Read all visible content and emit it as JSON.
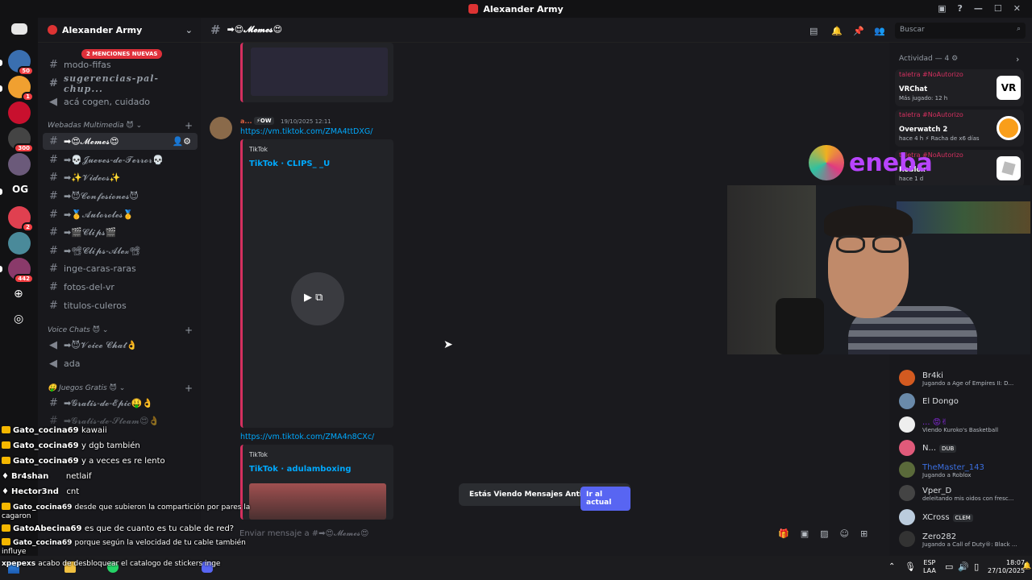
{
  "window": {
    "title": "Alexander Army"
  },
  "servers": {
    "badges": [
      "50",
      "1",
      "300",
      "2",
      "442"
    ],
    "og_label": "OG"
  },
  "server": {
    "name": "Alexander Army",
    "mention_banner": "2 MENCIONES NUEVAS"
  },
  "channels": {
    "top": [
      {
        "label": "modo-fifas"
      },
      {
        "label": "sugerencias-pal-chup..."
      },
      {
        "label": "acá cogen, cuidado"
      }
    ],
    "cat_media": "Webadas Multimedia",
    "media": [
      {
        "label": "➡😍𝓜𝓮𝓶𝓮𝓼😍"
      },
      {
        "label": "➡💀𝓙𝓾𝓮𝓿𝓮𝓼-𝓭𝓮-𝓣𝓮𝓻𝓻𝓸𝓻💀"
      },
      {
        "label": "➡✨𝓥𝓲𝓭𝓮𝓸𝓼✨"
      },
      {
        "label": "➡😈𝓒𝓸𝓷𝓯𝓮𝓼𝓲𝓸𝓷𝓮𝓼😈"
      },
      {
        "label": "➡🥇𝓐𝓾𝓽𝓸𝓻𝓸𝓵𝓮𝓼🥇"
      },
      {
        "label": "➡🎬𝓒𝓵𝓲𝓹𝓼🎬"
      },
      {
        "label": "➡📽𝓒𝓵𝓲𝓹𝓼-𝓐𝓵𝓮𝔁📽"
      },
      {
        "label": "inge-caras-raras"
      },
      {
        "label": "fotos-del-vr"
      },
      {
        "label": "titulos-culeros"
      }
    ],
    "cat_voice": "Voice Chats",
    "voice": [
      {
        "label": "➡😈𝓥𝓸𝓲𝓬𝓮 𝓒𝓱𝓪𝓽👌"
      },
      {
        "label": "ada"
      }
    ],
    "cat_games": "Juegos Gratis",
    "games": [
      {
        "label": "➡𝓖𝓻𝓪𝓽𝓲𝓼-𝓭𝓮-𝓔𝓹𝓲𝓬🤑👌"
      },
      {
        "label": "➡𝓖𝓻𝓪𝓽𝓲𝓼-𝓭𝓮-𝓢𝓽𝓮𝓪𝓶😍👌"
      }
    ]
  },
  "header": {
    "channel": "➡😍𝓜𝓮𝓶𝓮𝓼😍",
    "search_placeholder": "Buscar"
  },
  "messages": [
    {
      "author": "a...",
      "badge": "⚡OW",
      "time": "19/10/2025 12:11",
      "link": "https://vm.tiktok.com/ZMA4ttDXG/",
      "provider": "TikTok",
      "embed_title": "TikTok · CLIPS_ _U"
    },
    {
      "link": "https://vm.tiktok.com/ZMA4n8CXc/",
      "provider": "TikTok",
      "embed_title": "TikTok · adulamboxing"
    }
  ],
  "old_messages": {
    "text": "Estás Viendo Mensajes Antiguos",
    "button": "Ir al actual"
  },
  "composer": {
    "placeholder": "Enviar mensaje a #➡😍𝓜𝓮𝓶𝓮𝓼😍"
  },
  "activity": {
    "header": "Actividad — 4",
    "cards": [
      {
        "user": "taletra #NoAutorizo",
        "game": "VRChat",
        "sub": "Más jugado: 12 h",
        "logo": "VR"
      },
      {
        "user": "taletra #NoAutorizo",
        "game": "Overwatch 2",
        "sub": "hace 4 h  ⚡ Racha de x6 días",
        "logo": ""
      },
      {
        "user": "taletra #NoAutorizo",
        "game": "Roblox",
        "sub": "hace 1 d",
        "logo": ""
      }
    ]
  },
  "members": [
    {
      "name": "Br4ki",
      "status": "Jugando a Age of Empires II: D...",
      "color": "#dbdee1",
      "tag": ""
    },
    {
      "name": "El Dongo",
      "status": "",
      "color": "#dbdee1",
      "tag": ""
    },
    {
      "name": "...",
      "status": "Viendo Kuroko's Basketball",
      "color": "#8a2be2",
      "tag": ""
    },
    {
      "name": "N...",
      "status": "",
      "color": "#dbdee1",
      "tag": "DUB"
    },
    {
      "name": "TheMaster_143",
      "status": "Jugando a Roblox",
      "color": "#3b6fe0",
      "tag": ""
    },
    {
      "name": "Vper_D",
      "status": "deleitando mis oidos con fresc...",
      "color": "#dbdee1",
      "tag": ""
    },
    {
      "name": "XCross",
      "status": "",
      "color": "#dbdee1",
      "tag": "CLEM"
    },
    {
      "name": "Zero282",
      "status": "Jugando a Call of Duty®: Black ...",
      "color": "#dbdee1",
      "tag": ""
    }
  ],
  "sponsor": {
    "name": "eneba"
  },
  "stream_chat": [
    {
      "user": "Gato_cocina69",
      "msg": "kawaii"
    },
    {
      "user": "Gato_cocina69",
      "msg": "y dgb también"
    },
    {
      "user": "Gato_cocina69",
      "msg": "y a veces es re lento"
    },
    {
      "user": "Br4shan",
      "msg": "netlaif"
    },
    {
      "user": "Hector3nd",
      "msg": "cnt"
    },
    {
      "user": "Gato_cocina69",
      "msg": "desde que subieron la compartición por pares la cagaron"
    },
    {
      "user": "GatoAbecina69",
      "msg": "es que de cuanto es tu cable de red?"
    },
    {
      "user": "Gato_cocina69",
      "msg": "porque según la velocidad de tu cable también influye"
    },
    {
      "user": "xpepexs",
      "msg": "acabo de desbloquear el catalogo de stickers inge"
    }
  ],
  "taskbar": {
    "lang": "ESP",
    "lang2": "LAA",
    "time": "18:07",
    "date": "27/10/2025"
  }
}
